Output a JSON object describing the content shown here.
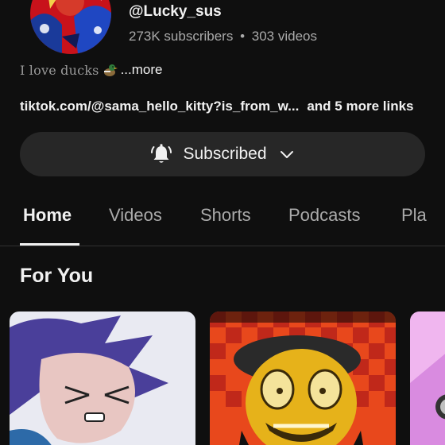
{
  "channel": {
    "handle": "@Lucky_sus",
    "subscribers": "273K subscribers",
    "separator": "•",
    "videos": "303 videos",
    "bio_text": "I love ducks",
    "bio_emoji": "duck-emoji",
    "more_label": "...more",
    "link_text": "tiktok.com/@sama_hello_kitty?is_from_w...",
    "more_links": "and 5 more links"
  },
  "subscribe": {
    "label": "Subscribed",
    "icon": "bell-icon",
    "chevron": "chevron-down-icon"
  },
  "tabs": [
    {
      "label": "Home",
      "active": true
    },
    {
      "label": "Videos",
      "active": false
    },
    {
      "label": "Shorts",
      "active": false
    },
    {
      "label": "Podcasts",
      "active": false
    },
    {
      "label": "Pla",
      "active": false
    }
  ],
  "section": {
    "title": "For You"
  },
  "colors": {
    "background": "#0f0f0f",
    "button_bg": "#272727",
    "text_primary": "#f1f1f1",
    "text_secondary": "#aaaaaa"
  }
}
